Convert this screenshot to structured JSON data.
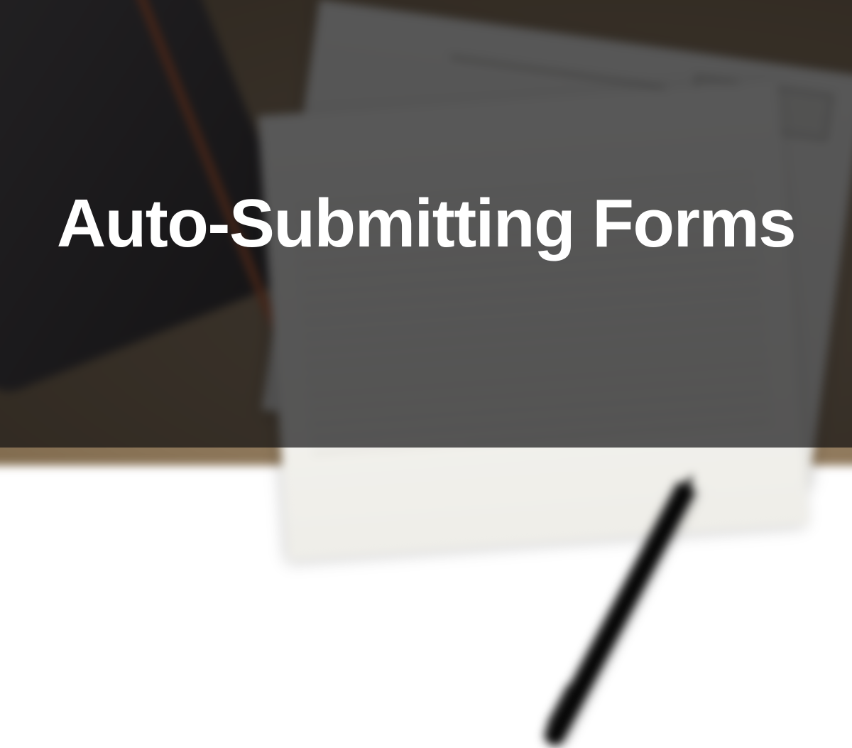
{
  "title": "Auto-Submitting Forms"
}
